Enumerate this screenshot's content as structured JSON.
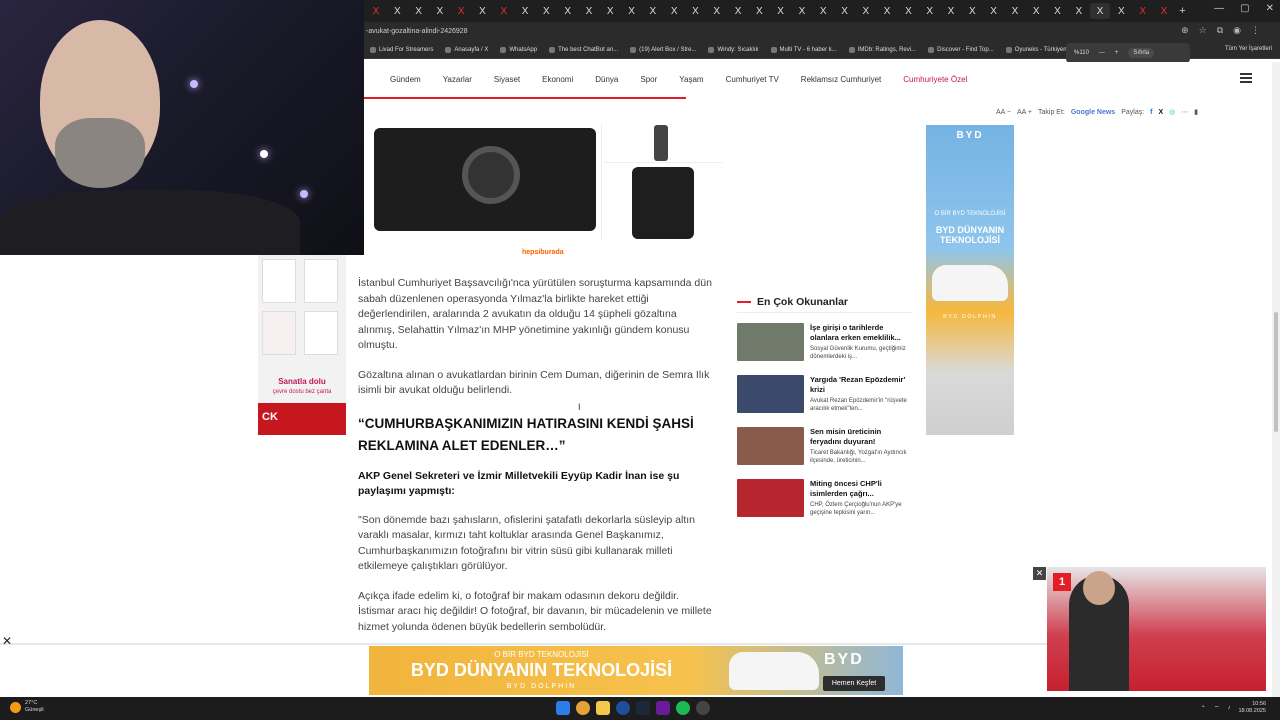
{
  "browser": {
    "url": "-avukat-gozaltina-alindi-2426928",
    "tab_glyph": "X",
    "tab_count": 38,
    "bookmarks": [
      "Livad For Streamers",
      "Anasayfa / X",
      "WhatsApp",
      "The best ChatBot an...",
      "(19) Alert Box / Stre...",
      "Windy: Sıcaklık",
      "Multi TV - 6 haber k...",
      "IMDb: Ratings, Revi...",
      "Discover - Find Top...",
      "Oyuneks - Türkiyeni..."
    ],
    "zoom_level": "%110",
    "zoom_reset": "Sıfırla",
    "all_bookmarks": "Tüm Yer İşaretleri"
  },
  "nav": {
    "items": [
      "Gündem",
      "Yazarlar",
      "Siyaset",
      "Ekonomi",
      "Dünya",
      "Spor",
      "Yaşam",
      "Cumhuriyet TV",
      "Reklamsız Cumhuriyet",
      "Cumhuriyete Özel"
    ]
  },
  "toolbar": {
    "font_small": "A",
    "font_large": "A",
    "follow_label": "Takip Et:",
    "google_news": "Google News",
    "share_label": "Paylaş:"
  },
  "products": {
    "store_label": "hepsiburada"
  },
  "left_ad": {
    "title": "Sanatla dolu",
    "subtitle": "çevre dostu bez çanta",
    "brand": "CK"
  },
  "article": {
    "para1": "İstanbul Cumhuriyet Başsavcılığı'nca yürütülen soruşturma kapsamında dün sabah düzenlenen operasyonda Yılmaz'la birlikte hareket ettiği değerlendirilen, aralarında 2 avukatın da olduğu 14 şüpheli gözaltına alınmış, Selahattin Yılmaz'ın MHP yönetimine yakınlığı gündem konusu olmuştu.",
    "para2": "Gözaltına alınan o avukatlardan birinin Cem Duman, diğerinin de Semra Ilık isimli bir avukat olduğu belirlendi.",
    "headline": "“CUMHURBAŞKANIMIZIN HATIRASINI KENDİ ŞAHSİ REKLAMINA ALET EDENLER…”",
    "bold_para": "AKP Genel Sekreteri ve İzmir Milletvekili Eyyüp Kadir İnan ise şu paylaşımı yapmıştı:",
    "quote1": "\"Son dönemde bazı şahısların, ofislerini şatafatlı dekorlarla süsleyip altın varaklı masalar, kırmızı taht koltuklar arasında Genel Başkanımız, Cumhurbaşkanımızın fotoğrafını bir vitrin süsü gibi kullanarak milleti etkilemeye çalıştıkları görülüyor.",
    "quote2": "Açıkça ifade edelim ki, o fotoğraf bir makam odasının dekoru değildir. İstismar aracı hiç değildir! O fotoğraf, bir davanın, bir mücadelenin ve millete hizmet yolunda ödenen büyük bedellerin sembolüdür."
  },
  "popular": {
    "title": "En Çok Okunanlar",
    "items": [
      {
        "headline": "İşe girişi o tarihlerde olanlara erken emeklilik...",
        "summary": "Sosyal Güvenlik Kurumu, geçtiğimiz dönemlerdeki iş...",
        "thumb_color": "#6f7a6a"
      },
      {
        "headline": "Yargıda 'Rezan Epözdemir' krizi",
        "summary": "Avukat Rezan Epözdemir'in \"rüşvete aracılık etmek\"ten...",
        "thumb_color": "#3b4a6b"
      },
      {
        "headline": "Sen misin üreticinin feryadını duyuran!",
        "summary": "Ticaret Bakanlığı, Yozgat'ın Aydıncık ilçesinde, üreticinin...",
        "thumb_color": "#8a5a4a"
      },
      {
        "headline": "Miting öncesi CHP'li isimlerden çağrı...",
        "summary": "CHP, Özlem Çerçioğlu'nun AKP'ye geçişine tepkisini yarın...",
        "thumb_color": "#b5262e"
      }
    ]
  },
  "right_ad": {
    "brand": "BYD",
    "line1": "O BİR BYD TEKNOLOJİSİ",
    "line2": "BYD DÜNYANIN TEKNOLOJİSİ",
    "model": "BYD DOLPHIN"
  },
  "bottom_ad": {
    "line1": "O BİR BYD TEKNOLOJİSİ",
    "line2": "BYD DÜNYANIN TEKNOLOJİSİ",
    "model": "BYD DOLPHIN",
    "brand": "BYD",
    "cta": "Hemen Keşfet"
  },
  "video": {
    "channel_badge": "1"
  },
  "taskbar": {
    "temperature": "27°C",
    "condition": "Güneşli",
    "time": "10:56",
    "date": "18.08.2025"
  },
  "colors": {
    "accent_red": "#e31e24",
    "special_nav": "#c2185b"
  }
}
